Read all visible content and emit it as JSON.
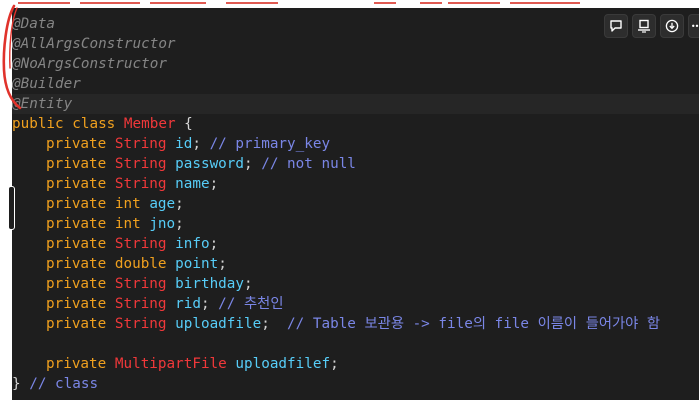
{
  "editor": {
    "annotations": [
      "@Data",
      "@AllArgsConstructor",
      "@NoArgsConstructor",
      "@Builder",
      "@Entity"
    ],
    "class_decl": {
      "kw": "public class ",
      "name": "Member",
      "brace": " {"
    },
    "fields": [
      {
        "mod": "private ",
        "type": "String",
        "type_kind": "ty",
        "name": "id",
        "rest": ";",
        "comment": " // primary_key"
      },
      {
        "mod": "private ",
        "type": "String",
        "type_kind": "ty",
        "name": "password",
        "rest": ";",
        "comment": " // not null"
      },
      {
        "mod": "private ",
        "type": "String",
        "type_kind": "ty",
        "name": "name",
        "rest": ";",
        "comment": ""
      },
      {
        "mod": "private ",
        "type": "int",
        "type_kind": "kw",
        "name": "age",
        "rest": ";",
        "comment": ""
      },
      {
        "mod": "private ",
        "type": "int",
        "type_kind": "kw",
        "name": "jno",
        "rest": ";",
        "comment": ""
      },
      {
        "mod": "private ",
        "type": "String",
        "type_kind": "ty",
        "name": "info",
        "rest": ";",
        "comment": ""
      },
      {
        "mod": "private ",
        "type": "double",
        "type_kind": "kw",
        "name": "point",
        "rest": ";",
        "comment": ""
      },
      {
        "mod": "private ",
        "type": "String",
        "type_kind": "ty",
        "name": "birthday",
        "rest": ";",
        "comment": ""
      },
      {
        "mod": "private ",
        "type": "String",
        "type_kind": "ty",
        "name": "rid",
        "rest": ";",
        "comment": " // 추천인"
      },
      {
        "mod": "private ",
        "type": "String",
        "type_kind": "ty",
        "name": "uploadfile",
        "rest": ";",
        "comment": "  // Table 보관용 -> file의 file 이름이 들어가야 함"
      }
    ],
    "multipart": {
      "mod": "private ",
      "type": "MultipartFile",
      "name": "uploadfilef",
      "rest": ";"
    },
    "closing": {
      "brace": "} ",
      "comment": "// class"
    }
  },
  "toolbar": {
    "icons": [
      "comment-icon",
      "present-icon",
      "download-icon",
      "more-icon"
    ],
    "more_glyph": "•••"
  },
  "colors": {
    "background": "#1e1e1e",
    "annotation": "#858585",
    "keyword": "#f0a01e",
    "type": "#f0383a",
    "identifier": "#57cdf8",
    "comment": "#7a86e6",
    "markup_red": "#e0322b"
  }
}
